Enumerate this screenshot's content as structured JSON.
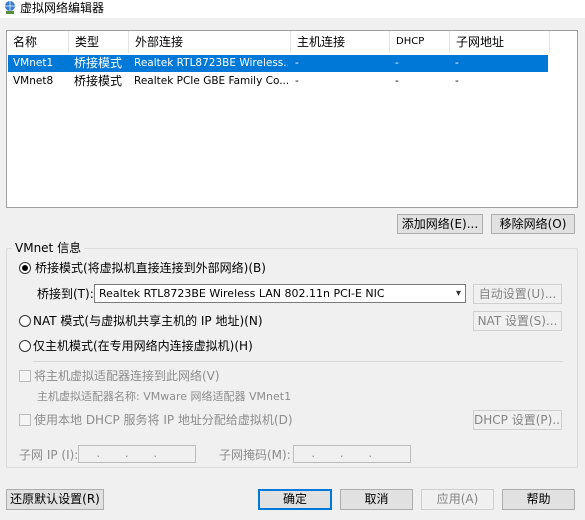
{
  "window": {
    "title": "虚拟网络编辑器",
    "icon": "network-globe-icon"
  },
  "network_table": {
    "headers": [
      "名称",
      "类型",
      "外部连接",
      "主机连接",
      "DHCP",
      "子网地址"
    ],
    "rows": [
      {
        "name": "VMnet1",
        "type": "桥接模式",
        "external": "Realtek RTL8723BE Wireless...",
        "host": "-",
        "dhcp": "-",
        "subnet": "-",
        "selected": true
      },
      {
        "name": "VMnet8",
        "type": "桥接模式",
        "external": "Realtek PCIe GBE Family Co...",
        "host": "-",
        "dhcp": "-",
        "subnet": "-",
        "selected": false
      }
    ]
  },
  "table_buttons": {
    "add": "添加网络(E)...",
    "remove": "移除网络(O)"
  },
  "vmnet_info": {
    "group_label": "VMnet 信息",
    "bridged": {
      "label": "桥接模式(将虚拟机直接连接到外部网络)(B)",
      "checked": true
    },
    "bridge_to": {
      "label": "桥接到(T):",
      "value": "Realtek RTL8723BE Wireless LAN 802.11n PCI-E NIC",
      "auto_button": "自动设置(U)..."
    },
    "nat": {
      "label": "NAT 模式(与虚拟机共享主机的 IP 地址)(N)",
      "button": "NAT 设置(S)..."
    },
    "host_only": {
      "label": "仅主机模式(在专用网络内连接虚拟机)(H)"
    },
    "connect_adapter": {
      "label": "将主机虚拟适配器连接到此网络(V)"
    },
    "adapter_name": {
      "label": "主机虚拟适配器名称: VMware 网络适配器 VMnet1"
    },
    "use_dhcp": {
      "label": "使用本地 DHCP 服务将 IP 地址分配给虚拟机(D)",
      "button": "DHCP 设置(P)..."
    },
    "subnet_ip": {
      "label": "子网 IP (I):",
      "value": " .  .  . "
    },
    "subnet_mask": {
      "label": "子网掩码(M):",
      "value": " .  .  . "
    }
  },
  "footer": {
    "restore": "还原默认设置(R)",
    "ok": "确定",
    "cancel": "取消",
    "apply": "应用(A)",
    "help": "帮助"
  }
}
